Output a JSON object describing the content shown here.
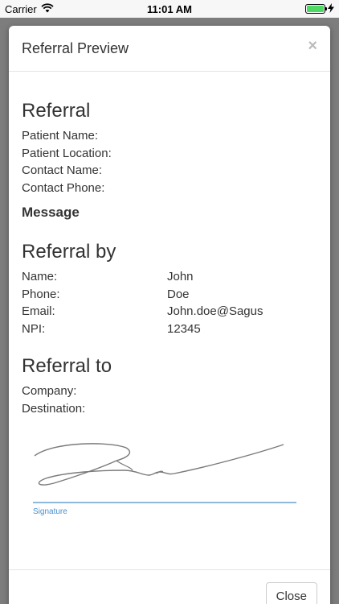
{
  "status_bar": {
    "carrier": "Carrier",
    "time": "11:01 AM"
  },
  "modal": {
    "title": "Referral Preview",
    "close_icon": "×",
    "referral": {
      "heading": "Referral",
      "fields": [
        "Patient Name:",
        "Patient Location:",
        "Contact Name:",
        "Contact Phone:"
      ],
      "message_heading": "Message"
    },
    "referral_by": {
      "heading": "Referral by",
      "rows": [
        {
          "label": "Name:",
          "value": "John"
        },
        {
          "label": "Phone:",
          "value": "Doe"
        },
        {
          "label": "Email:",
          "value": "John.doe@Sagus"
        },
        {
          "label": "NPI:",
          "value": "12345"
        }
      ]
    },
    "referral_to": {
      "heading": "Referral to",
      "fields": [
        "Company:",
        "Destination:"
      ]
    },
    "signature_label": "Signature",
    "close_button": "Close"
  },
  "icons": {
    "wifi": "wifi-icon",
    "battery": "battery-icon",
    "charging": "charging-bolt-icon",
    "close": "close-icon"
  },
  "colors": {
    "battery_green": "#4cd964",
    "signature_line": "#8fb8dd",
    "signature_label": "#4a8fcf"
  }
}
